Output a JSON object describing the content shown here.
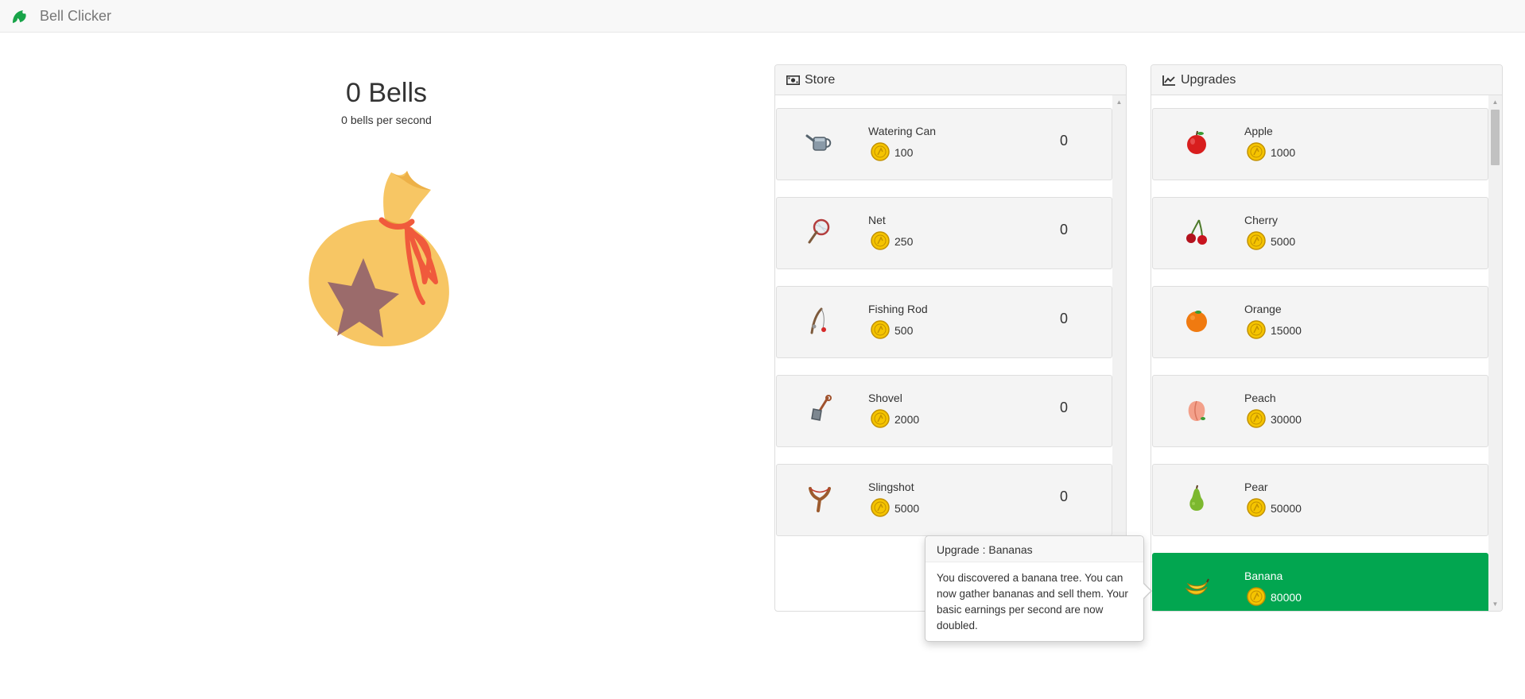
{
  "app": {
    "title": "Bell Clicker",
    "brand_icon": "leaf-icon"
  },
  "counter": {
    "bells_label": "0 Bells",
    "bps_label": "0 bells per second",
    "bag_icon": "money-bag-icon"
  },
  "store": {
    "title": "Store",
    "icon": "money-icon",
    "items": [
      {
        "name": "Watering Can",
        "price": "100",
        "count": "0",
        "icon": "watering-can-icon"
      },
      {
        "name": "Net",
        "price": "250",
        "count": "0",
        "icon": "net-icon"
      },
      {
        "name": "Fishing Rod",
        "price": "500",
        "count": "0",
        "icon": "fishing-rod-icon"
      },
      {
        "name": "Shovel",
        "price": "2000",
        "count": "0",
        "icon": "shovel-icon"
      },
      {
        "name": "Slingshot",
        "price": "5000",
        "count": "0",
        "icon": "slingshot-icon"
      }
    ]
  },
  "upgrades": {
    "title": "Upgrades",
    "icon": "line-chart-icon",
    "items": [
      {
        "name": "Apple",
        "price": "1000",
        "icon": "apple-icon"
      },
      {
        "name": "Cherry",
        "price": "5000",
        "icon": "cherry-icon"
      },
      {
        "name": "Orange",
        "price": "15000",
        "icon": "orange-icon"
      },
      {
        "name": "Peach",
        "price": "30000",
        "icon": "peach-icon"
      },
      {
        "name": "Pear",
        "price": "50000",
        "icon": "pear-icon"
      },
      {
        "name": "Banana",
        "price": "80000",
        "icon": "banana-icon",
        "active": true
      }
    ]
  },
  "tooltip": {
    "title": "Upgrade : Bananas",
    "body": "You discovered a banana tree. You can now gather bananas and sell them. Your basic earnings per second are now doubled."
  },
  "colors": {
    "active": "#02a650",
    "coin": "#f5c400",
    "bag": "#f7c664",
    "ribbon": "#f05a3c",
    "star": "#9b6b6b"
  }
}
